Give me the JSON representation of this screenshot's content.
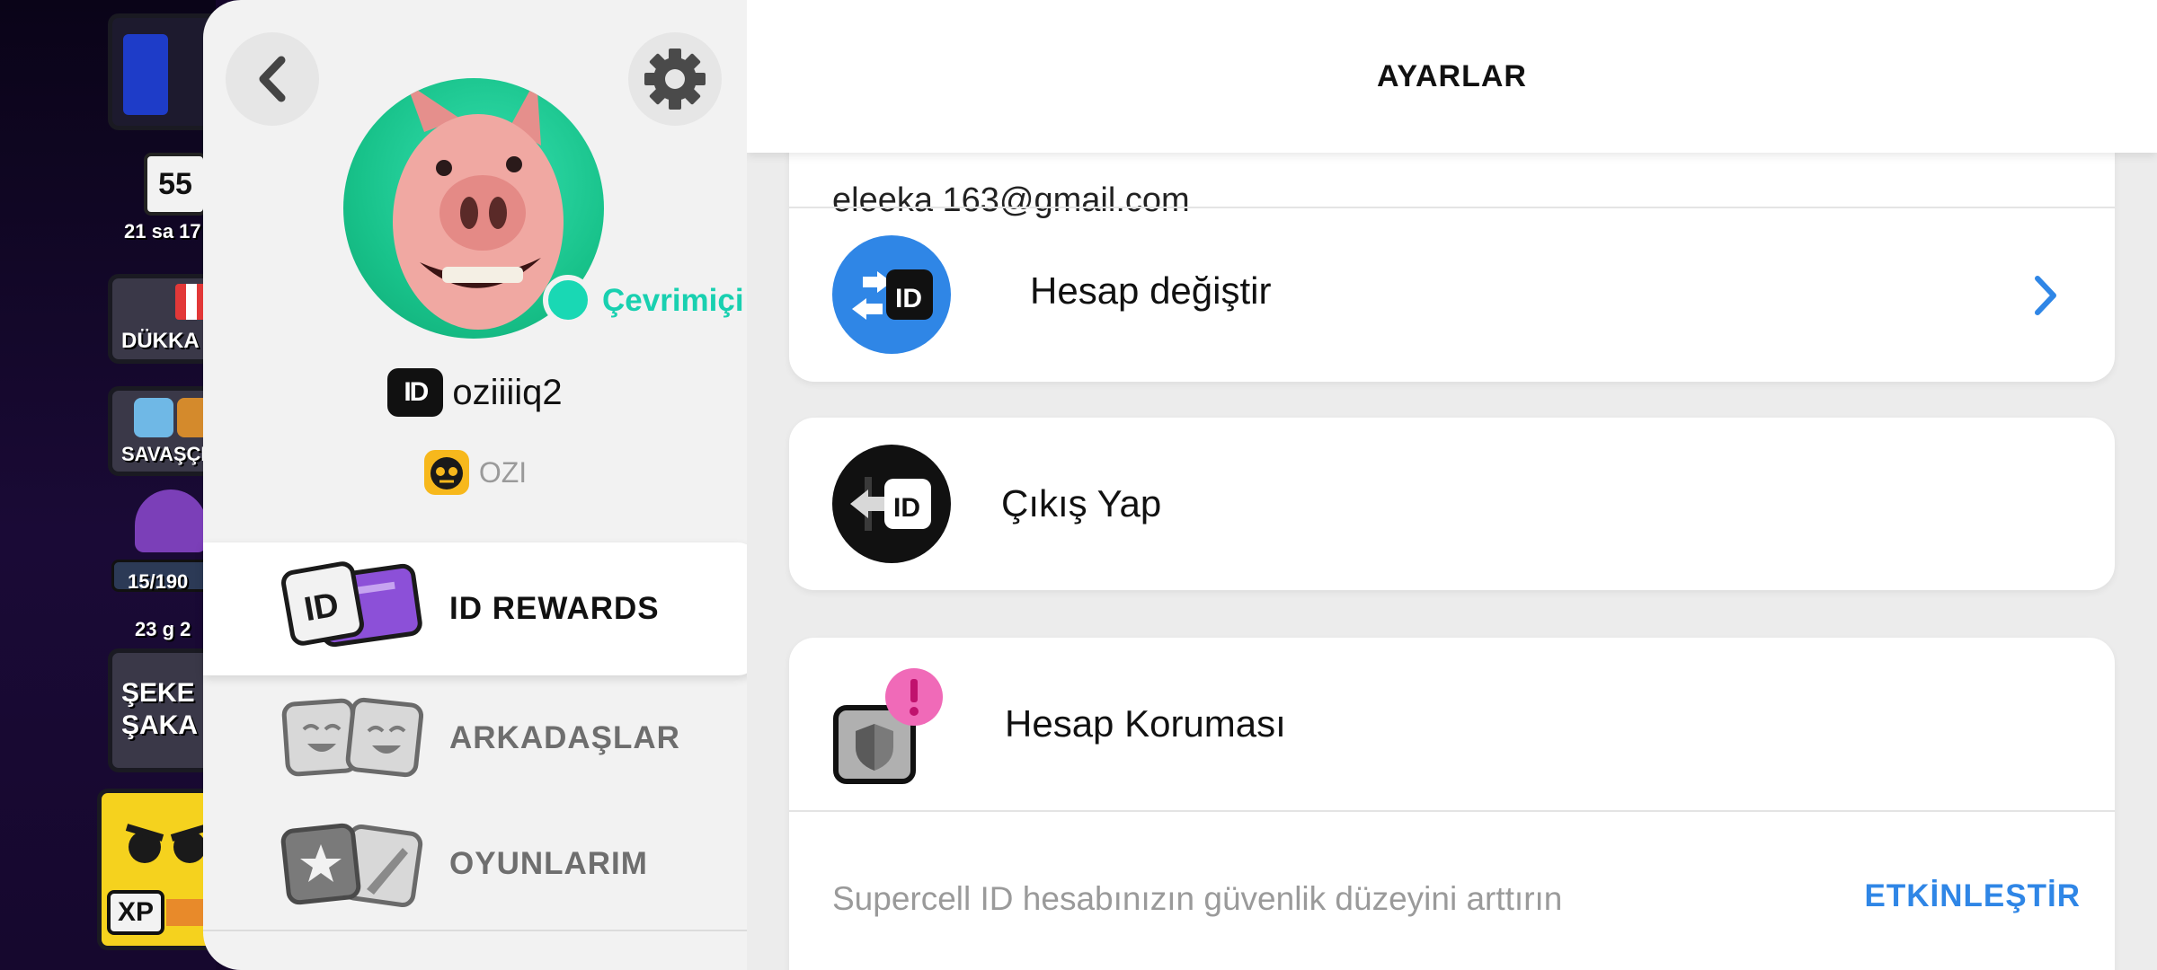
{
  "game_sidebar": {
    "event_days": "55",
    "event_timer": "21 sa 17",
    "shop_label": "DÜKKA",
    "brawlers_label": "SAVAŞÇI",
    "trophy_progress": "15/190",
    "timer_2": "23 g 2",
    "event_label_line1": "ŞEKE",
    "event_label_line2": "ŞAKA",
    "xp_label": "XP"
  },
  "profile": {
    "status": "Çevrimiçi",
    "id_badge": "ID",
    "username": "oziiiiq2",
    "club_name": "OZI"
  },
  "menu": [
    {
      "label": "ID REWARDS",
      "active": true
    },
    {
      "label": "ARKADAŞLAR",
      "active": false
    },
    {
      "label": "OYUNLARIM",
      "active": false
    }
  ],
  "settings": {
    "title": "AYARLAR",
    "email_partial": "eleeka 163@gmail.com",
    "switch_account_label": "Hesap değiştir",
    "logout_label": "Çıkış Yap",
    "protection_label": "Hesap Koruması",
    "protection_hint": "Supercell ID hesabınızın güvenlik düzeyini arttırın",
    "protection_cta": "ETKİNLEŞTİR",
    "id_icon_text": "ID"
  },
  "colors": {
    "accent_blue": "#2f86e6",
    "online_green": "#19d0b0",
    "alert_pink": "#f06ab8"
  },
  "icons": {
    "back": "chevron-left-icon",
    "settings": "gear-icon",
    "switch_account": "switch-account-icon",
    "logout": "logout-icon",
    "protection": "shield-icon"
  }
}
